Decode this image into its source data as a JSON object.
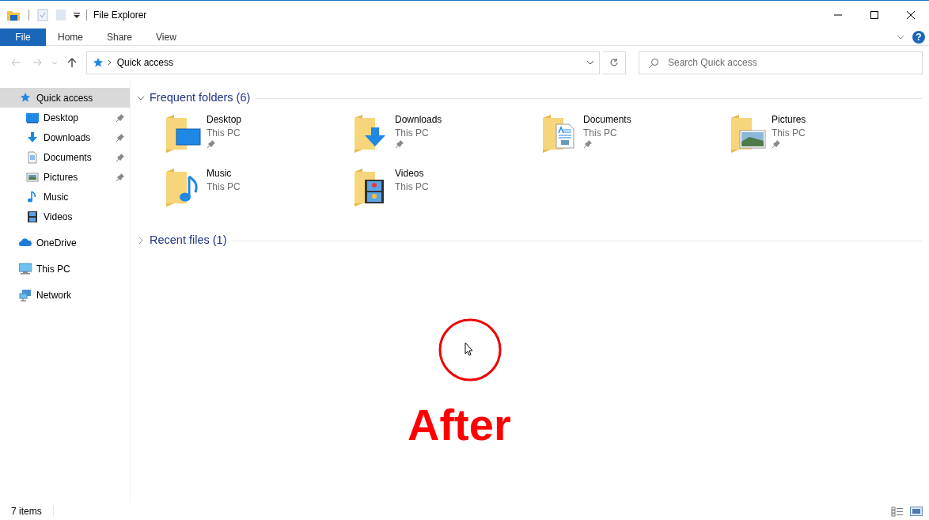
{
  "window": {
    "title": "File Explorer"
  },
  "ribbon_tabs": [
    {
      "label": "File",
      "kind": "file"
    },
    {
      "label": "Home",
      "kind": "tab"
    },
    {
      "label": "Share",
      "kind": "tab"
    },
    {
      "label": "View",
      "kind": "tab"
    }
  ],
  "address_bar": {
    "path": "Quick access"
  },
  "search": {
    "placeholder": "Search Quick access"
  },
  "help_button": {
    "label": "?"
  },
  "sidebar": {
    "items": [
      {
        "label": "Quick access",
        "kind": "star",
        "selected": true,
        "children": [
          {
            "label": "Desktop",
            "kind": "desktop",
            "pinned": true,
            "selected": false
          },
          {
            "label": "Downloads",
            "kind": "downloads",
            "pinned": true,
            "selected": false
          },
          {
            "label": "Documents",
            "kind": "documents",
            "pinned": true,
            "selected": false
          },
          {
            "label": "Pictures",
            "kind": "pictures",
            "pinned": true,
            "selected": false
          },
          {
            "label": "Music",
            "kind": "music",
            "pinned": false,
            "selected": false
          },
          {
            "label": "Videos",
            "kind": "videos",
            "pinned": false,
            "selected": false
          }
        ]
      },
      {
        "label": "OneDrive",
        "kind": "cloud",
        "selected": false
      },
      {
        "label": "This PC",
        "kind": "pc",
        "selected": false
      },
      {
        "label": "Network",
        "kind": "network",
        "selected": false
      }
    ]
  },
  "sections": [
    {
      "title": "Frequent folders (6)",
      "expanded": true,
      "items": [
        {
          "name": "Desktop",
          "location": "This PC",
          "kind": "desktop",
          "pinned": true
        },
        {
          "name": "Downloads",
          "location": "This PC",
          "kind": "downloads",
          "pinned": true
        },
        {
          "name": "Documents",
          "location": "This PC",
          "kind": "documents",
          "pinned": true
        },
        {
          "name": "Pictures",
          "location": "This PC",
          "kind": "pictures",
          "pinned": true
        },
        {
          "name": "Music",
          "location": "This PC",
          "kind": "music",
          "pinned": false
        },
        {
          "name": "Videos",
          "location": "This PC",
          "kind": "videos",
          "pinned": false
        }
      ]
    },
    {
      "title": "Recent files (1)",
      "expanded": false
    }
  ],
  "status_bar": {
    "count": "7 items"
  },
  "annotation": {
    "label": "After"
  }
}
